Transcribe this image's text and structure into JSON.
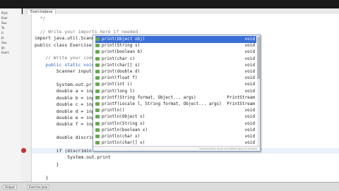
{
  "tabs": {
    "active": "ExerciseJava"
  },
  "project_panel": [
    "Prjct",
    "Exer",
    "Sou",
    "Te",
    "Li",
    "Ja",
    "Sou",
    "gs",
    "Exerc"
  ],
  "editor": {
    "lines": [
      {
        "text": "  */",
        "cls": "c"
      },
      {
        "text": "",
        "cls": "t"
      },
      {
        "text": "  // Write your imports here if needed",
        "cls": "c"
      },
      {
        "text": "import java.util.Scanner;",
        "cls": "t"
      },
      {
        "text": "public class Exercise",
        "cls": "t"
      },
      {
        "text": "",
        "cls": "t"
      },
      {
        "text": "    // Write your code",
        "cls": "c"
      },
      {
        "text": "    public static void",
        "cls": "k"
      },
      {
        "text": "        Scanner input",
        "cls": "t"
      },
      {
        "text": "",
        "cls": "t"
      },
      {
        "text": "        System.out.pr",
        "cls": "t"
      },
      {
        "text": "        double a = inp",
        "cls": "t"
      },
      {
        "text": "        double b = inp",
        "cls": "t"
      },
      {
        "text": "        double c = inp",
        "cls": "t"
      },
      {
        "text": "        double d = inp",
        "cls": "t"
      },
      {
        "text": "        double e = inp",
        "cls": "t"
      },
      {
        "text": "        double f = inp",
        "cls": "t"
      },
      {
        "text": "",
        "cls": "t"
      },
      {
        "text": "        double discrim",
        "cls": "t"
      },
      {
        "text": "",
        "cls": "t"
      },
      {
        "text": "        if (discrimin",
        "cls": "t"
      },
      {
        "text": "            System.out.print",
        "cls": "t"
      },
      {
        "text": "        }",
        "cls": "t"
      },
      {
        "text": "",
        "cls": "t"
      },
      {
        "text": "    }",
        "cls": "t"
      }
    ]
  },
  "completion": {
    "items": [
      {
        "sig": "print(Object obj)",
        "ret": "void",
        "selected": true
      },
      {
        "sig": "print(String s)",
        "ret": "void"
      },
      {
        "sig": "print(boolean b)",
        "ret": "void"
      },
      {
        "sig": "print(char c)",
        "ret": "void"
      },
      {
        "sig": "print(char[] s)",
        "ret": "void"
      },
      {
        "sig": "print(double d)",
        "ret": "void"
      },
      {
        "sig": "print(float f)",
        "ret": "void"
      },
      {
        "sig": "print(int i)",
        "ret": "void"
      },
      {
        "sig": "print(long l)",
        "ret": "void"
      },
      {
        "sig": "printf(String format, Object... args)",
        "ret": "PrintStream"
      },
      {
        "sig": "printf(Locale l, String format, Object... args)",
        "ret": "PrintStream"
      },
      {
        "sig": "println()",
        "ret": "void"
      },
      {
        "sig": "println(Object x)",
        "ret": "void"
      },
      {
        "sig": "println(String x)",
        "ret": "void"
      },
      {
        "sig": "println(boolean x)",
        "ret": "void"
      },
      {
        "sig": "println(char x)",
        "ret": "void"
      },
      {
        "sig": "println(char[] x)",
        "ret": "void"
      }
    ],
    "footer": "Imported Items; Press 'Ctrl+SPACE' Again for All Items"
  },
  "status": {
    "output": "Output",
    "exercise": "Exercise Java"
  }
}
